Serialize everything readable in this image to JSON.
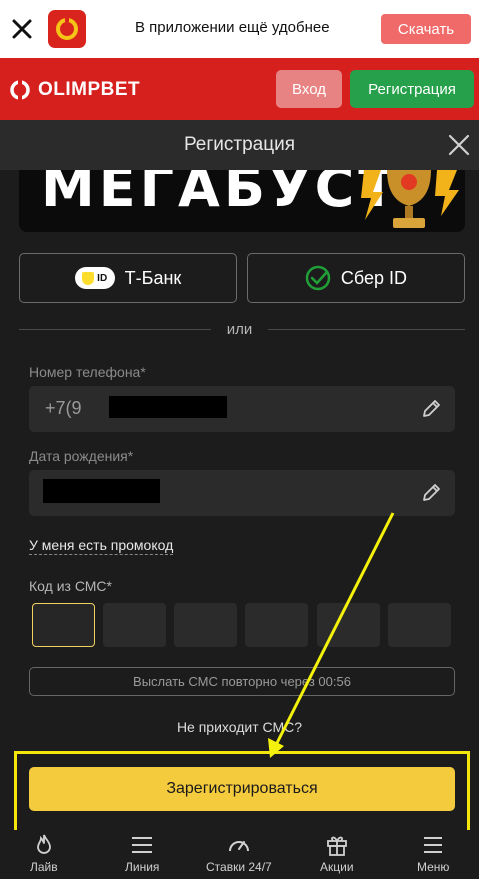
{
  "app_banner": {
    "text": "В приложении ещё удобнее",
    "download_label": "Скачать"
  },
  "header": {
    "brand": "OLIMPBET",
    "login_label": "Вход",
    "register_label": "Регистрация"
  },
  "modal": {
    "title": "Регистрация"
  },
  "promo_banner": {
    "text": "МЕГАБУСТ"
  },
  "bank_buttons": {
    "tbank_badge": "ID",
    "tbank_label": "Т-Банк",
    "sber_label": "Сбер ID"
  },
  "divider_text": "или",
  "phone": {
    "label": "Номер телефона*",
    "value": "+7(9"
  },
  "birthdate": {
    "label": "Дата рождения*"
  },
  "promo_code_link": "У меня есть промокод",
  "sms": {
    "label": "Код из СМС*",
    "boxes": 6,
    "resend_label": "Выслать СМС повторно через 00:56",
    "no_sms_label": "Не приходит СМС?"
  },
  "submit_label": "Зарегистрироваться",
  "bottom_nav": [
    {
      "label": "Лайв",
      "icon": "fire-icon"
    },
    {
      "label": "Линия",
      "icon": "list-icon"
    },
    {
      "label": "Ставки 24/7",
      "icon": "speedometer-icon"
    },
    {
      "label": "Акции",
      "icon": "gift-icon"
    },
    {
      "label": "Меню",
      "icon": "menu-icon"
    }
  ],
  "colors": {
    "brand_red": "#d6201d",
    "register_green": "#26a04a",
    "submit_yellow": "#f5cb3e",
    "highlight": "#f4e60a"
  }
}
